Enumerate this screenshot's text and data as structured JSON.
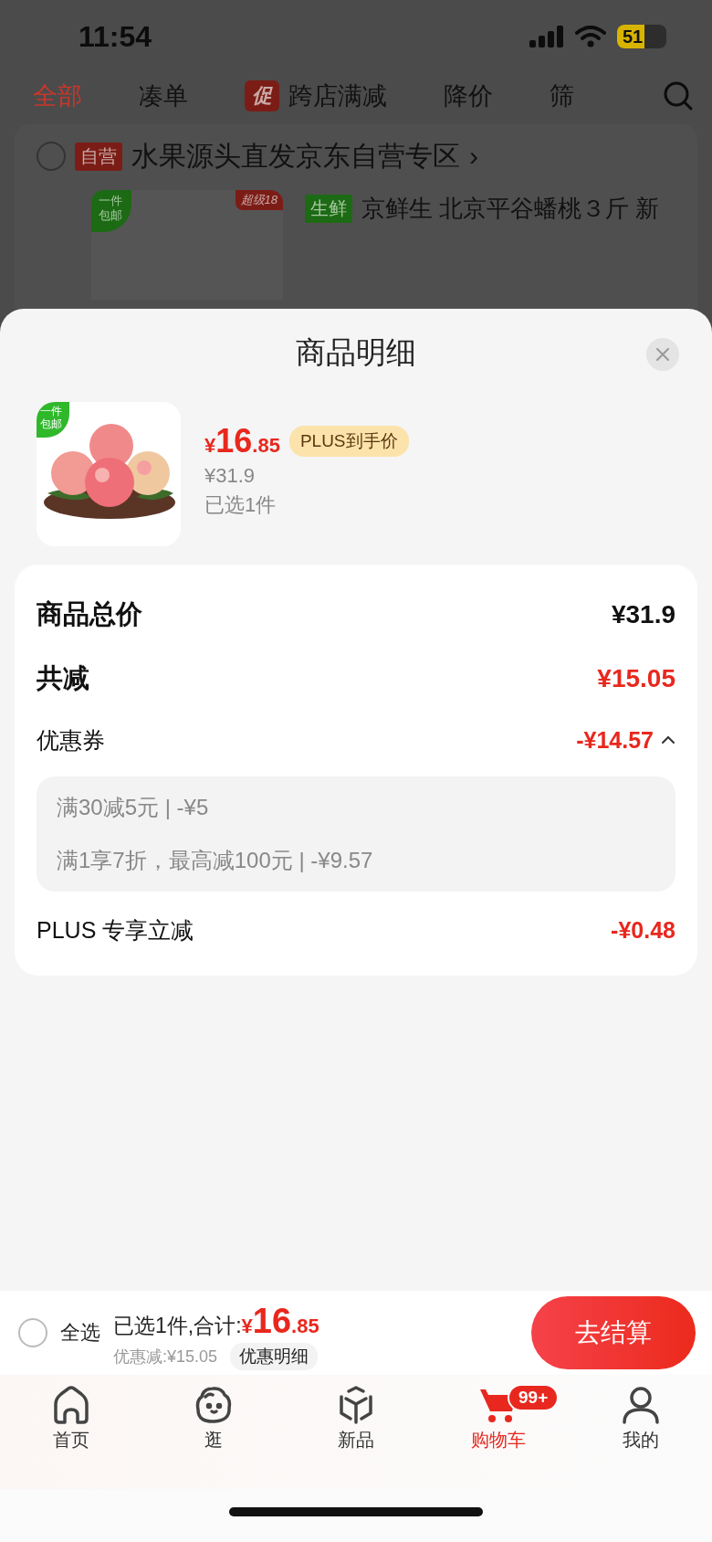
{
  "status_bar": {
    "time": "11:54",
    "battery": "51"
  },
  "filter_tabs": [
    {
      "label": "全部",
      "selected": true
    },
    {
      "label": "凑单",
      "selected": false
    },
    {
      "label": "跨店满减",
      "badge": "促",
      "selected": false
    },
    {
      "label": "降价",
      "selected": false
    },
    {
      "label": "筛",
      "selected": false
    }
  ],
  "shop": {
    "checked": false,
    "tag": "自营",
    "name": "水果源头直发京东自营专区",
    "arrow": "›"
  },
  "background_item": {
    "badge": "一件包邮",
    "corner_tag": "超级18",
    "category": "生鲜",
    "title": "京鲜生 北京平谷蟠桃３斤 新"
  },
  "sheet": {
    "title": "商品明细",
    "product": {
      "badge": "一件包邮",
      "price_symbol": "¥",
      "price_int": "16",
      "price_dec": ".85",
      "price_tag": "PLUS到手价",
      "original_price": "¥31.9",
      "selected_count": "已选1件"
    },
    "summary": [
      {
        "kind": "total",
        "label": "商品总价",
        "value": "¥31.9"
      },
      {
        "kind": "discount",
        "label": "共减",
        "value": "¥15.05"
      },
      {
        "kind": "coupon",
        "label": "优惠券",
        "value": "-¥14.57",
        "expanded": true,
        "details": [
          "满30减5元 | -¥5",
          "满1享7折，最高减100元 | -¥9.57"
        ]
      },
      {
        "kind": "plus",
        "label": "PLUS 专享立减",
        "value": "-¥0.48"
      }
    ]
  },
  "checkout_bar": {
    "select_all": {
      "label": "全选",
      "checked": false
    },
    "summary": "已选1件,合计:",
    "price_symbol": "¥",
    "price_int": "16",
    "price_dec": ".85",
    "saved": "优惠减:¥15.05",
    "detail_button": "优惠明细",
    "checkout_button": "去结算"
  },
  "nav": [
    {
      "kind": "home",
      "label": "首页",
      "selected": false
    },
    {
      "kind": "browse",
      "label": "逛",
      "selected": false
    },
    {
      "kind": "new",
      "label": "新品",
      "selected": false
    },
    {
      "kind": "cart",
      "label": "购物车",
      "badge": "99+",
      "selected": true
    },
    {
      "kind": "profile",
      "label": "我的",
      "selected": false
    }
  ]
}
